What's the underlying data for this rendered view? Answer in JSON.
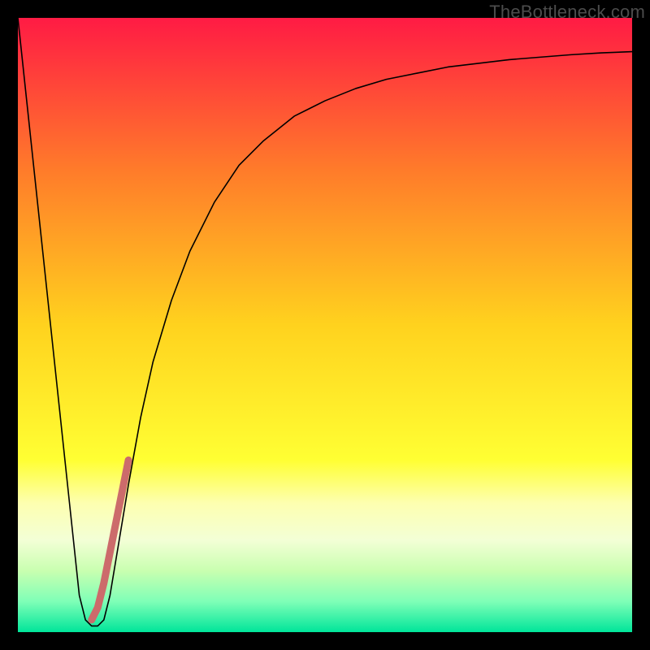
{
  "watermark": "TheBottleneck.com",
  "chart_data": {
    "type": "line",
    "title": "",
    "xlabel": "",
    "ylabel": "",
    "xlim": [
      0,
      100
    ],
    "ylim": [
      0,
      100
    ],
    "grid": false,
    "background_gradient": {
      "stops": [
        {
          "pct": 0,
          "color": "#ff1b44"
        },
        {
          "pct": 25,
          "color": "#ff7c2a"
        },
        {
          "pct": 50,
          "color": "#ffd21e"
        },
        {
          "pct": 72,
          "color": "#ffff33"
        },
        {
          "pct": 79,
          "color": "#fdffb0"
        },
        {
          "pct": 85,
          "color": "#f3ffd6"
        },
        {
          "pct": 90,
          "color": "#c9ffb0"
        },
        {
          "pct": 95,
          "color": "#7fffb7"
        },
        {
          "pct": 100,
          "color": "#00e59a"
        }
      ]
    },
    "series": [
      {
        "name": "bottleneck-curve",
        "color": "#000000",
        "width": 1.6,
        "x": [
          0,
          5,
          10,
          11,
          12,
          13,
          14,
          15,
          16,
          18,
          20,
          22,
          25,
          28,
          32,
          36,
          40,
          45,
          50,
          55,
          60,
          65,
          70,
          75,
          80,
          85,
          90,
          95,
          100
        ],
        "y": [
          100,
          53,
          6,
          2,
          1,
          1,
          2,
          6,
          12,
          24,
          35,
          44,
          54,
          62,
          70,
          76,
          80,
          84,
          86.5,
          88.5,
          90,
          91,
          92,
          92.6,
          93.2,
          93.6,
          94,
          94.3,
          94.5
        ]
      },
      {
        "name": "highlight-segment",
        "color": "#cc6b6b",
        "width": 9,
        "linecap": "round",
        "x": [
          12.0,
          13.0,
          14.0,
          15.0,
          16.0,
          17.0,
          18.0
        ],
        "y": [
          2.0,
          4.0,
          8.0,
          13.0,
          18.0,
          23.0,
          28.0
        ]
      }
    ]
  }
}
